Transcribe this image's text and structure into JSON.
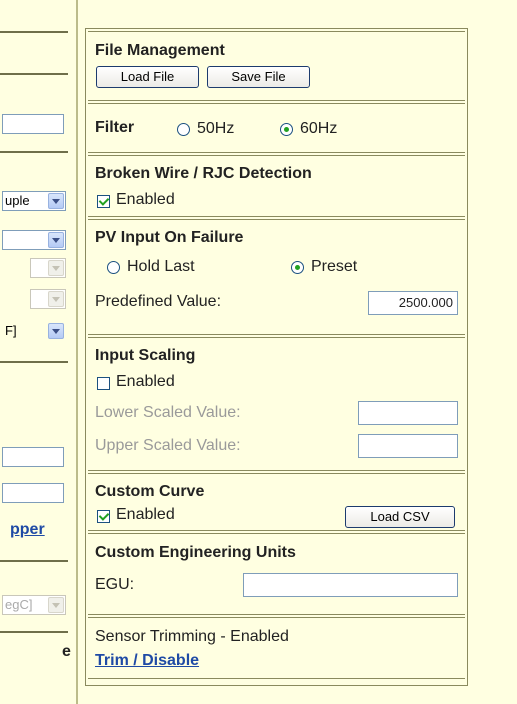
{
  "left_panel": {
    "select1": "uple",
    "select4": "F]",
    "link": "pper",
    "select5": "egC]",
    "heading_fragment": "e"
  },
  "file_management": {
    "title": "File Management",
    "load_label": "Load File",
    "save_label": "Save File"
  },
  "filter": {
    "title": "Filter",
    "option_50": "50Hz",
    "option_60": "60Hz",
    "selected": "60Hz"
  },
  "broken_wire": {
    "title": "Broken Wire / RJC Detection",
    "enabled_label": "Enabled",
    "enabled": true
  },
  "pv_input": {
    "title": "PV Input On Failure",
    "hold_last": "Hold Last",
    "preset": "Preset",
    "selected": "Preset",
    "predefined_label": "Predefined Value:",
    "predefined_value": "2500.000"
  },
  "input_scaling": {
    "title": "Input Scaling",
    "enabled_label": "Enabled",
    "enabled": false,
    "lower_label": "Lower Scaled Value:",
    "upper_label": "Upper Scaled Value:",
    "lower_value": "",
    "upper_value": ""
  },
  "custom_curve": {
    "title": "Custom Curve",
    "enabled_label": "Enabled",
    "enabled": true,
    "load_csv_label": "Load CSV"
  },
  "engineering_units": {
    "title": "Custom Engineering Units",
    "egu_label": "EGU:",
    "egu_value": ""
  },
  "sensor_trimming": {
    "status": "Sensor Trimming -  Enabled",
    "link_label": "Trim / Disable"
  },
  "colors": {
    "background": "#ffffe1",
    "link": "#1f4aa5",
    "check": "#21a121",
    "border": "#8a8a5e"
  }
}
